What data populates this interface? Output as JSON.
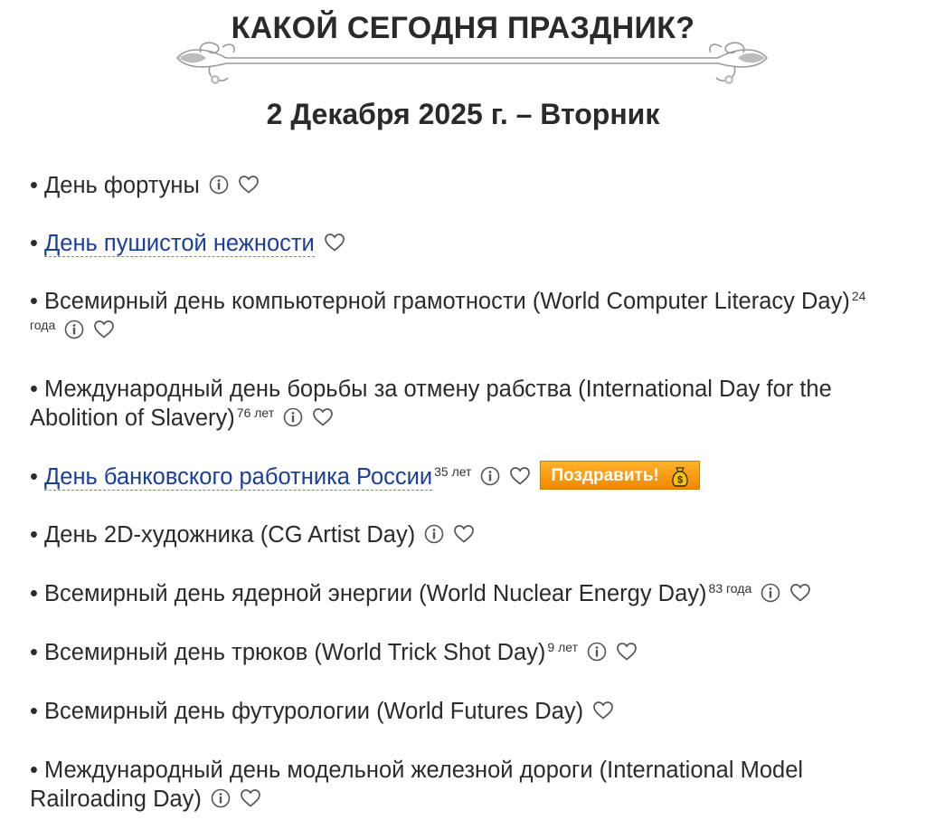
{
  "header": {
    "title": "КАКОЙ СЕГОДНЯ ПРАЗДНИК?",
    "date": "2 Декабря 2025 г. – Вторник"
  },
  "icons": {
    "info": "info-icon",
    "favorite": "heart-icon",
    "money": "moneybag-icon"
  },
  "colors": {
    "link": "#1a3e9e",
    "button": "#f39200",
    "text": "#2b2b2b"
  },
  "holidays": [
    {
      "text": "День фортуны",
      "years": ""
    },
    {
      "text": "День пушистой нежности",
      "years": ""
    },
    {
      "text": "Всемирный день компьютерной грамотности (World Computer Literacy Day)",
      "years": "24 года"
    },
    {
      "text": "Международный день борьбы за отмену рабства (International Day for the Abolition of Slavery)",
      "years": "76 лет"
    },
    {
      "text": "День банковского работника России",
      "years": "35 лет",
      "button": "Поздравить!"
    },
    {
      "text": "День 2D-художника (CG Artist Day)",
      "years": ""
    },
    {
      "text": "Всемирный день ядерной энергии (World Nuclear Energy Day)",
      "years": "83 года"
    },
    {
      "text": "Всемирный день трюков (World Trick Shot Day)",
      "years": "9 лет"
    },
    {
      "text": "Всемирный день футурологии (World Futures Day)",
      "years": ""
    },
    {
      "text": "Международный день модельной железной дороги (International Model Railroading Day)",
      "years": ""
    }
  ]
}
